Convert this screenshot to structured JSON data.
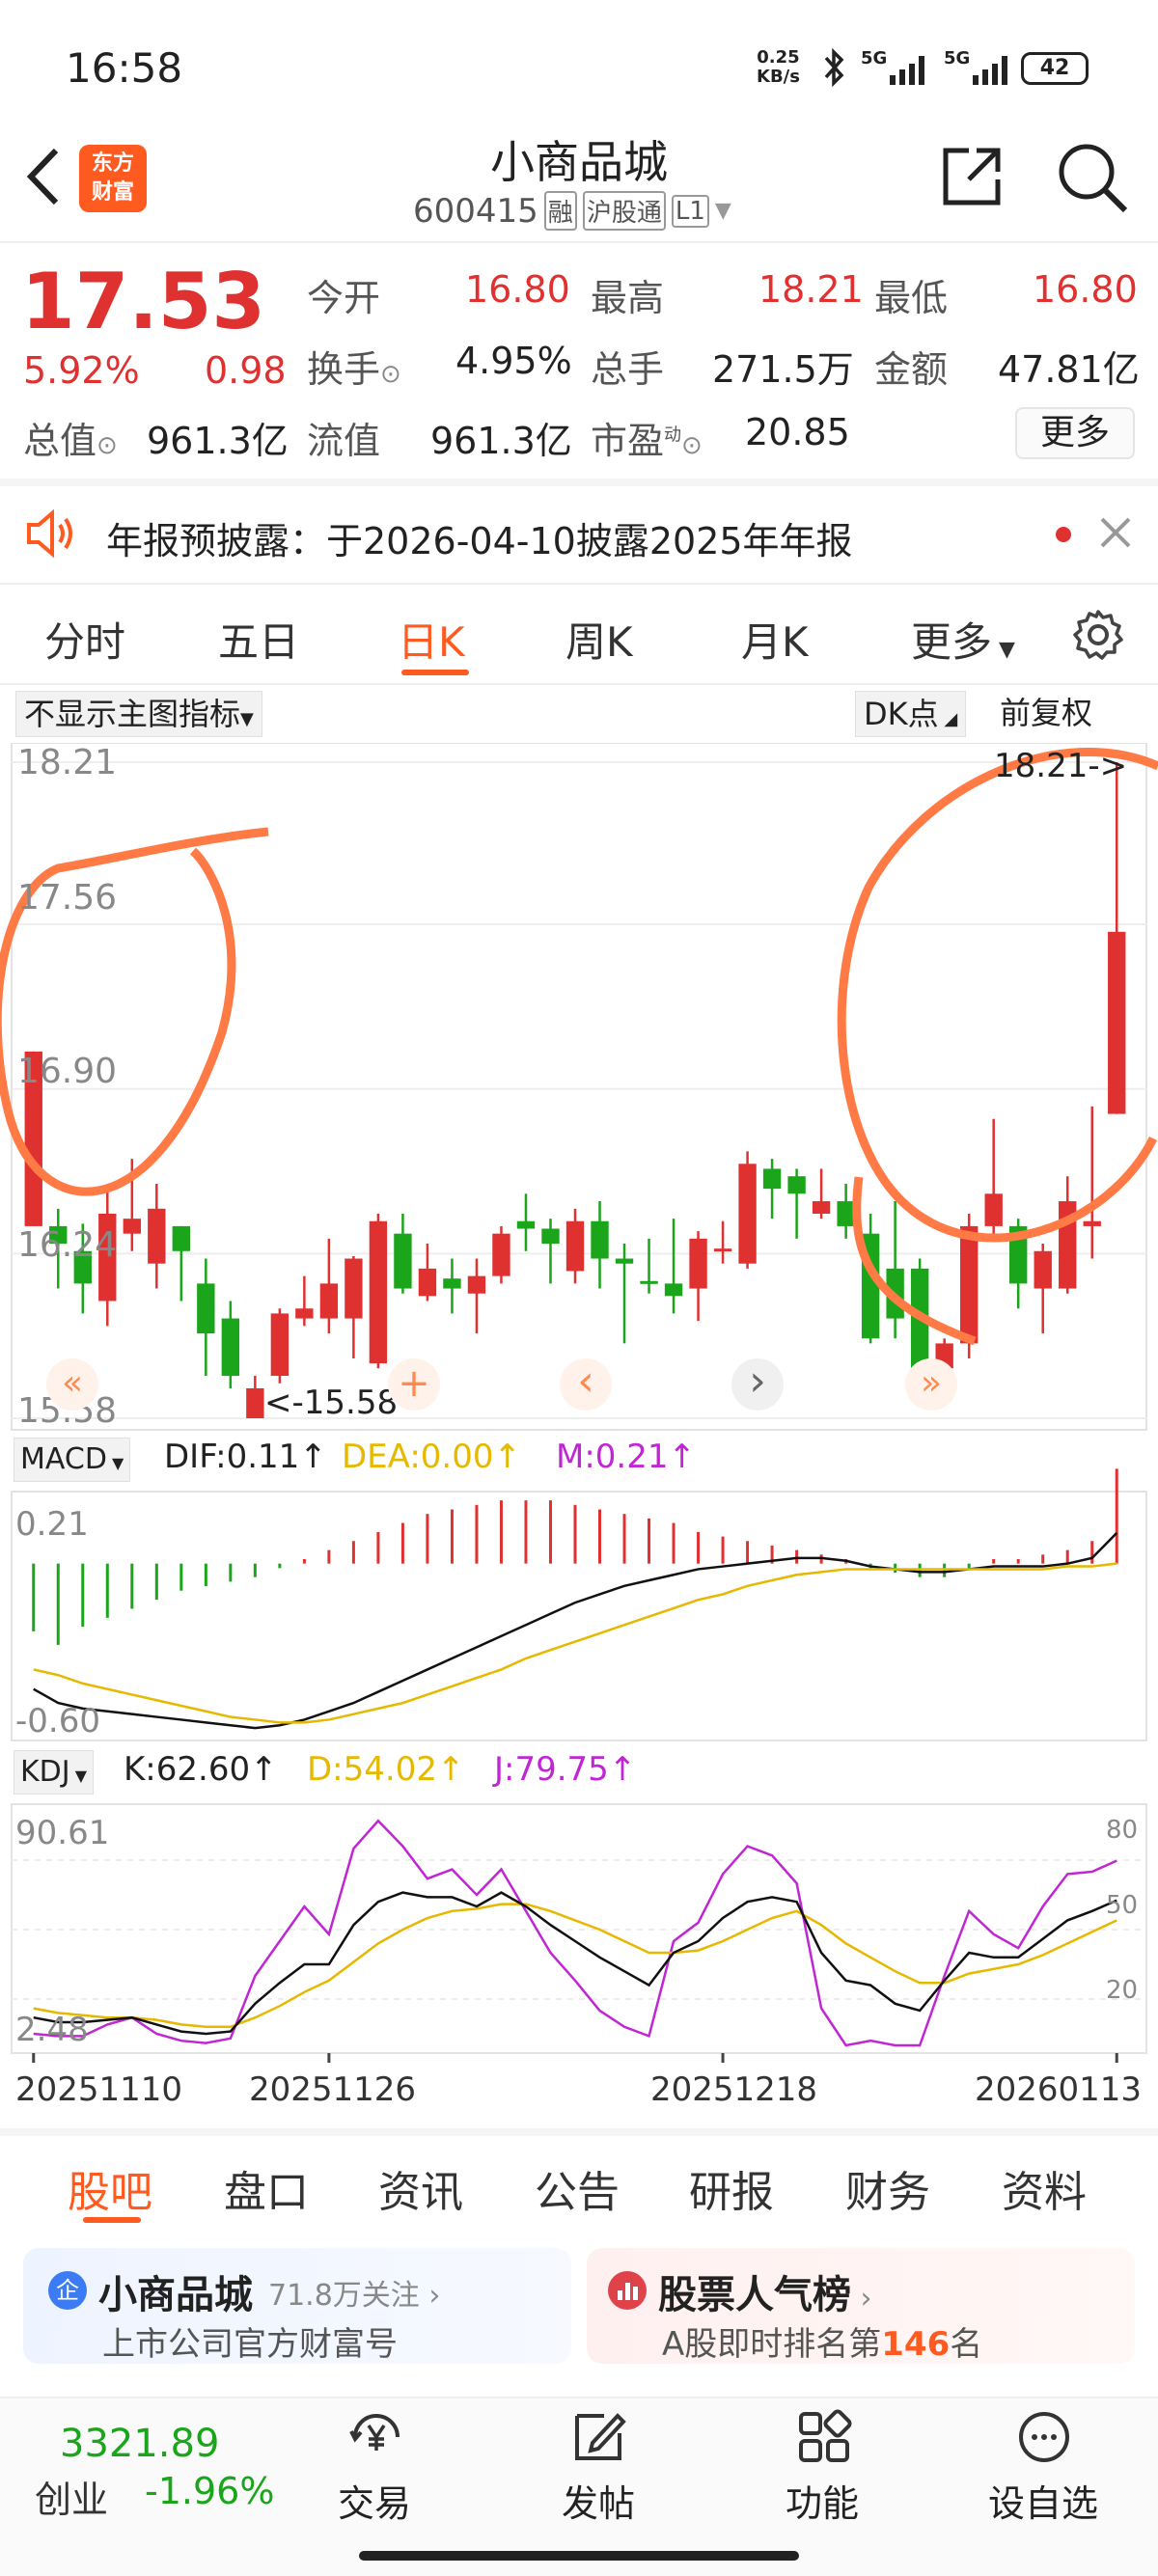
{
  "status": {
    "time": "16:58",
    "net_speed_top": "0.25",
    "net_speed_unit": "KB/s",
    "sig1": "5G",
    "sig2": "5G",
    "battery": "42"
  },
  "header": {
    "title": "小商品城",
    "code": "600415",
    "tag1": "融",
    "tag2": "沪股通",
    "tag3": "L1",
    "logo_top": "东方",
    "logo_bottom": "财富"
  },
  "quote": {
    "price": "17.53",
    "pct": "5.92%",
    "chg": "0.98",
    "rows": [
      [
        {
          "k": "今开",
          "v": "16.80",
          "red": true
        },
        {
          "k": "最高",
          "v": "18.21",
          "red": true
        },
        {
          "k": "最低",
          "v": "16.80",
          "red": true
        }
      ],
      [
        {
          "k": "换手",
          "v": "4.95%",
          "red": false
        },
        {
          "k": "总手",
          "v": "271.5万",
          "red": false
        },
        {
          "k": "金额",
          "v": "47.81亿",
          "red": false
        }
      ],
      [
        {
          "k": "总值",
          "v": "961.3亿",
          "red": false
        },
        {
          "k": "流值",
          "v": "961.3亿",
          "red": false
        },
        {
          "k": "市盈",
          "v": "20.85",
          "red": false
        }
      ]
    ],
    "more": "更多",
    "dyn": "动"
  },
  "notice": {
    "text": "年报预披露：于2026-04-10披露2025年年报"
  },
  "tabs": [
    "分时",
    "五日",
    "日K",
    "周K",
    "月K",
    "更多"
  ],
  "active_tab": "日K",
  "chart_toolbar": {
    "indicator": "不显示主图指标",
    "dk": "DK点",
    "adj": "前复权"
  },
  "chart_data": [
    {
      "type": "candlestick",
      "ylim": [
        15.58,
        18.21
      ],
      "ytick_labels": [
        "18.21",
        "17.56",
        "16.90",
        "16.24",
        "15.58"
      ],
      "yticks": [
        18.21,
        17.56,
        16.9,
        16.24,
        15.58
      ],
      "high_label": "18.21->",
      "low_label": "<-15.58",
      "xtick_labels": [
        "20251110",
        "20251126",
        "20251218",
        "20260113"
      ],
      "candles": [
        {
          "o": 16.35,
          "c": 17.05,
          "h": 17.05,
          "l": 16.35
        },
        {
          "o": 16.35,
          "c": 16.28,
          "h": 16.42,
          "l": 16.1
        },
        {
          "o": 16.25,
          "c": 16.12,
          "h": 16.36,
          "l": 16.0
        },
        {
          "o": 16.05,
          "c": 16.4,
          "h": 16.5,
          "l": 15.95
        },
        {
          "o": 16.32,
          "c": 16.38,
          "h": 16.62,
          "l": 16.25
        },
        {
          "o": 16.2,
          "c": 16.42,
          "h": 16.52,
          "l": 16.1
        },
        {
          "o": 16.35,
          "c": 16.25,
          "h": 16.35,
          "l": 16.05
        },
        {
          "o": 16.12,
          "c": 15.92,
          "h": 16.22,
          "l": 15.75
        },
        {
          "o": 15.98,
          "c": 15.75,
          "h": 16.05,
          "l": 15.7
        },
        {
          "o": 15.58,
          "c": 15.7,
          "h": 15.75,
          "l": 15.58
        },
        {
          "o": 15.75,
          "c": 16.0,
          "h": 16.02,
          "l": 15.72
        },
        {
          "o": 15.98,
          "c": 16.02,
          "h": 16.15,
          "l": 15.95
        },
        {
          "o": 15.98,
          "c": 16.12,
          "h": 16.3,
          "l": 15.92
        },
        {
          "o": 15.98,
          "c": 16.22,
          "h": 16.23,
          "l": 15.82
        },
        {
          "o": 15.8,
          "c": 16.37,
          "h": 16.4,
          "l": 15.78
        },
        {
          "o": 16.32,
          "c": 16.1,
          "h": 16.4,
          "l": 16.08
        },
        {
          "o": 16.07,
          "c": 16.18,
          "h": 16.28,
          "l": 16.05
        },
        {
          "o": 16.14,
          "c": 16.1,
          "h": 16.22,
          "l": 16.0
        },
        {
          "o": 16.08,
          "c": 16.15,
          "h": 16.22,
          "l": 15.92
        },
        {
          "o": 16.15,
          "c": 16.32,
          "h": 16.35,
          "l": 16.12
        },
        {
          "o": 16.37,
          "c": 16.34,
          "h": 16.48,
          "l": 16.25
        },
        {
          "o": 16.34,
          "c": 16.28,
          "h": 16.38,
          "l": 16.12
        },
        {
          "o": 16.17,
          "c": 16.37,
          "h": 16.42,
          "l": 16.12
        },
        {
          "o": 16.37,
          "c": 16.22,
          "h": 16.45,
          "l": 16.1
        },
        {
          "o": 16.22,
          "c": 16.2,
          "h": 16.28,
          "l": 15.88
        },
        {
          "o": 16.13,
          "c": 16.12,
          "h": 16.3,
          "l": 16.08
        },
        {
          "o": 16.12,
          "c": 16.07,
          "h": 16.38,
          "l": 16.0
        },
        {
          "o": 16.1,
          "c": 16.3,
          "h": 16.33,
          "l": 15.97
        },
        {
          "o": 16.25,
          "c": 16.26,
          "h": 16.37,
          "l": 16.2
        },
        {
          "o": 16.2,
          "c": 16.6,
          "h": 16.65,
          "l": 16.18
        },
        {
          "o": 16.58,
          "c": 16.5,
          "h": 16.62,
          "l": 16.38
        },
        {
          "o": 16.55,
          "c": 16.48,
          "h": 16.58,
          "l": 16.3
        },
        {
          "o": 16.4,
          "c": 16.45,
          "h": 16.58,
          "l": 16.38
        },
        {
          "o": 16.45,
          "c": 16.35,
          "h": 16.52,
          "l": 16.3
        },
        {
          "o": 16.32,
          "c": 15.9,
          "h": 16.4,
          "l": 15.88
        },
        {
          "o": 16.18,
          "c": 15.98,
          "h": 16.45,
          "l": 15.9
        },
        {
          "o": 16.18,
          "c": 15.78,
          "h": 16.22,
          "l": 15.72
        },
        {
          "o": 15.78,
          "c": 15.88,
          "h": 15.9,
          "l": 15.75
        },
        {
          "o": 15.88,
          "c": 16.35,
          "h": 16.4,
          "l": 15.82
        },
        {
          "o": 16.35,
          "c": 16.48,
          "h": 16.78,
          "l": 16.3
        },
        {
          "o": 16.35,
          "c": 16.12,
          "h": 16.38,
          "l": 16.02
        },
        {
          "o": 16.1,
          "c": 16.25,
          "h": 16.28,
          "l": 15.92
        },
        {
          "o": 16.1,
          "c": 16.45,
          "h": 16.55,
          "l": 16.08
        },
        {
          "o": 16.35,
          "c": 16.37,
          "h": 16.83,
          "l": 16.22
        },
        {
          "o": 16.8,
          "c": 17.53,
          "h": 18.21,
          "l": 16.8
        }
      ]
    },
    {
      "type": "bar+line",
      "name": "MACD",
      "labels": {
        "dif": "DIF:0.11",
        "dea": "DEA:0.00",
        "m": "M:0.21"
      },
      "ytick_labels": [
        "0.21",
        "-0.60"
      ],
      "ylim": [
        -0.6,
        0.21
      ],
      "hist": [
        -0.15,
        -0.18,
        -0.14,
        -0.12,
        -0.1,
        -0.08,
        -0.06,
        -0.05,
        -0.04,
        -0.03,
        -0.01,
        0.01,
        0.03,
        0.05,
        0.07,
        0.09,
        0.11,
        0.12,
        0.13,
        0.14,
        0.14,
        0.14,
        0.13,
        0.12,
        0.11,
        0.1,
        0.09,
        0.07,
        0.06,
        0.05,
        0.04,
        0.03,
        0.02,
        0.01,
        -0.01,
        -0.02,
        -0.03,
        -0.03,
        -0.01,
        0.01,
        0.01,
        0.02,
        0.03,
        0.05,
        0.21
      ],
      "dif": [
        -0.45,
        -0.5,
        -0.52,
        -0.53,
        -0.54,
        -0.55,
        -0.56,
        -0.57,
        -0.58,
        -0.59,
        -0.58,
        -0.56,
        -0.53,
        -0.5,
        -0.46,
        -0.42,
        -0.38,
        -0.34,
        -0.3,
        -0.26,
        -0.22,
        -0.18,
        -0.14,
        -0.11,
        -0.08,
        -0.06,
        -0.04,
        -0.02,
        -0.01,
        0.0,
        0.01,
        0.02,
        0.02,
        0.01,
        -0.01,
        -0.02,
        -0.03,
        -0.03,
        -0.02,
        -0.01,
        -0.01,
        -0.01,
        0.0,
        0.02,
        0.11
      ],
      "dea": [
        -0.38,
        -0.4,
        -0.43,
        -0.45,
        -0.47,
        -0.49,
        -0.51,
        -0.53,
        -0.55,
        -0.56,
        -0.57,
        -0.57,
        -0.56,
        -0.54,
        -0.52,
        -0.5,
        -0.47,
        -0.44,
        -0.41,
        -0.38,
        -0.34,
        -0.31,
        -0.28,
        -0.25,
        -0.22,
        -0.19,
        -0.16,
        -0.13,
        -0.11,
        -0.08,
        -0.06,
        -0.04,
        -0.03,
        -0.02,
        -0.02,
        -0.02,
        -0.02,
        -0.02,
        -0.02,
        -0.02,
        -0.02,
        -0.02,
        -0.01,
        -0.01,
        0.0
      ]
    },
    {
      "type": "line",
      "name": "KDJ",
      "labels": {
        "k": "K:62.60",
        "d": "D:54.02",
        "j": "J:79.75"
      },
      "ytick_labels": [
        "90.61",
        "2.48"
      ],
      "right_ticks": [
        "80",
        "50",
        "20"
      ],
      "ylim": [
        2.48,
        90.61
      ],
      "k": [
        12,
        10,
        10,
        11,
        12,
        9,
        6,
        5,
        6,
        18,
        27,
        35,
        35,
        52,
        62,
        66,
        64,
        64,
        60,
        66,
        60,
        52,
        45,
        38,
        32,
        26,
        40,
        45,
        55,
        62,
        64,
        62,
        40,
        28,
        26,
        18,
        15,
        28,
        40,
        38,
        38,
        46,
        54,
        58,
        62.6
      ],
      "d": [
        16,
        14,
        13,
        12,
        12,
        11,
        9,
        8,
        8,
        12,
        17,
        23,
        28,
        36,
        44,
        50,
        55,
        58,
        59,
        61,
        61,
        58,
        54,
        50,
        45,
        40,
        40,
        41,
        45,
        50,
        55,
        58,
        52,
        44,
        38,
        32,
        27,
        27,
        31,
        33,
        35,
        39,
        44,
        49,
        54.02
      ],
      "j": [
        5,
        4,
        4,
        9,
        12,
        5,
        2,
        1,
        3,
        30,
        45,
        60,
        48,
        85,
        97,
        86,
        72,
        76,
        65,
        76,
        58,
        40,
        28,
        15,
        8,
        4,
        45,
        53,
        74,
        86,
        82,
        70,
        16,
        0,
        2,
        0,
        0,
        30,
        58,
        48,
        42,
        60,
        74,
        75,
        79.75
      ]
    }
  ],
  "pager": {
    "first": "«",
    "plus": "+",
    "prev": "‹",
    "next": "›",
    "last": "»"
  },
  "bottom_tabs": [
    "股吧",
    "盘口",
    "资讯",
    "公告",
    "研报",
    "财务",
    "资料"
  ],
  "active_bottom_tab": "股吧",
  "cards": {
    "left_title": "小商品城",
    "left_follow": "71.8万关注",
    "left_sub": "上市公司官方财富号",
    "left_badge": "企",
    "right_title": "股票人气榜",
    "right_sub_pre": "A股即时排名第",
    "right_rank": "146",
    "right_sub_post": "名"
  },
  "footer": {
    "index": "3321.89",
    "index_name": "创业",
    "index_pct": "-1.96%",
    "items": [
      "交易",
      "发帖",
      "功能",
      "设自选"
    ]
  },
  "colors": {
    "up": "#e03131",
    "down": "#1aa51a",
    "accent": "#ff5a1f",
    "dea": "#e6b800",
    "j": "#c026d3",
    "circle": "#ff7a45"
  }
}
